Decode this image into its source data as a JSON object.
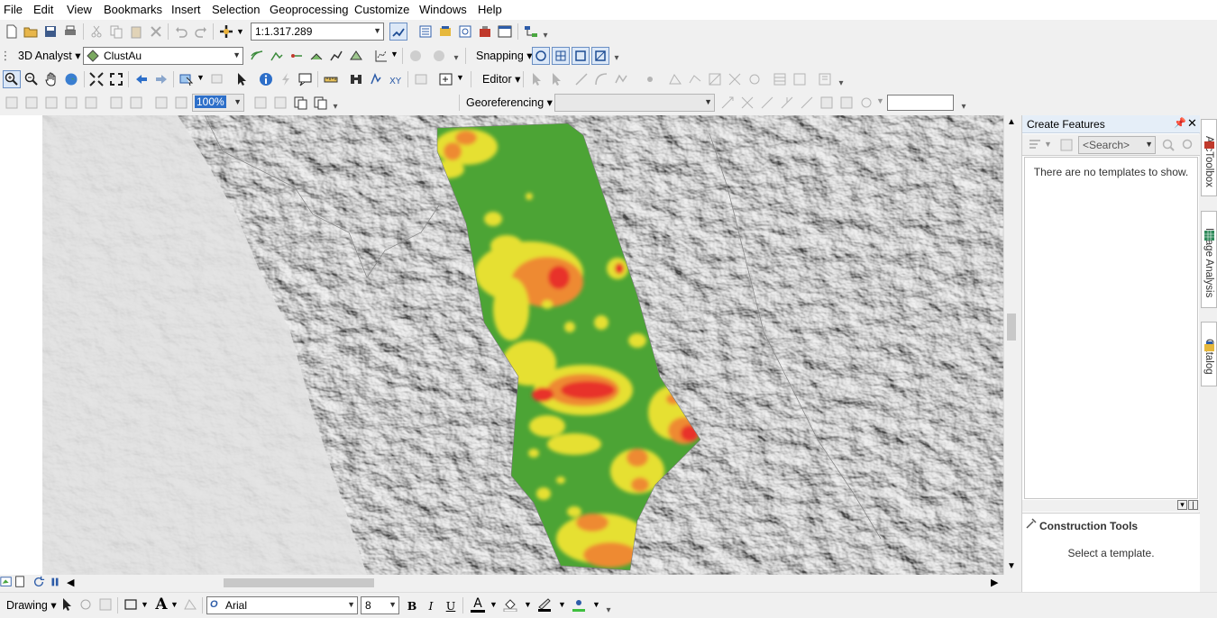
{
  "menubar": [
    "File",
    "Edit",
    "View",
    "Bookmarks",
    "Insert",
    "Selection",
    "Geoprocessing",
    "Customize",
    "Windows",
    "Help"
  ],
  "standard_toolbar": {
    "scale": "1:1.317.289"
  },
  "toolbar2": {
    "analyst_label": "3D Analyst",
    "layer_combo": "ClustAu",
    "snapping_label": "Snapping"
  },
  "toolbar3": {
    "editor_label": "Editor"
  },
  "toolbar4": {
    "georef_label": "Georeferencing",
    "zoom_percent": "100%"
  },
  "panel": {
    "title": "Create Features",
    "search_placeholder": "<Search>",
    "no_templates": "There are no templates to show.",
    "construction_title": "Construction Tools",
    "select_template": "Select a template."
  },
  "side_tabs": [
    "ArcToolbox",
    "Image Analysis",
    "Catalog"
  ],
  "drawing_toolbar": {
    "drawing_label": "Drawing",
    "font": "Arial",
    "font_size": "8",
    "bold": "B",
    "italic": "I",
    "underline": "U",
    "text_tool": "A"
  },
  "map_legend_colors": {
    "low": "#4ca435",
    "moderate": "#e6e033",
    "high": "#ee8a33",
    "very_high": "#e8332b"
  }
}
